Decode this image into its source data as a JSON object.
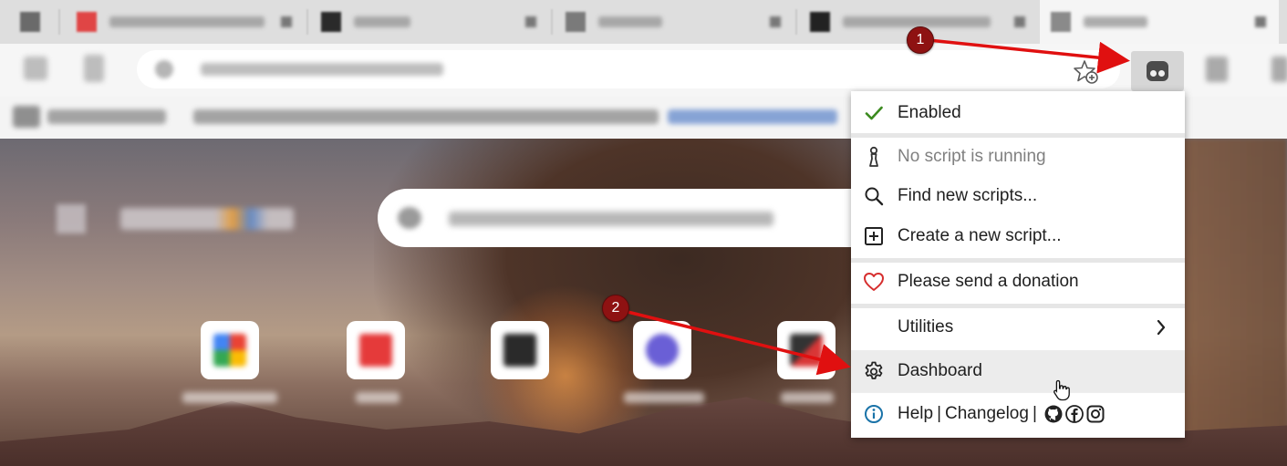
{
  "menu": {
    "enabled": "Enabled",
    "no_script": "No script is running",
    "find_scripts": "Find new scripts...",
    "create_script": "Create a new script...",
    "donation": "Please send a donation",
    "utilities": "Utilities",
    "dashboard": "Dashboard",
    "help": "Help",
    "help_sep1": "|",
    "changelog": "Changelog",
    "help_sep2": "|"
  },
  "annotations": {
    "step1": "1",
    "step2": "2"
  },
  "colors": {
    "check": "#3b8a1e",
    "heart": "#d62e2e",
    "info": "#1a73a8",
    "annotation": "#8e1212",
    "arrow": "#e01010"
  },
  "icons": {
    "enabled": "checkmark-icon",
    "no_script": "script-figure-icon",
    "find_scripts": "search-icon",
    "create_script": "plus-square-icon",
    "donation": "heart-icon",
    "utilities": "chevron-right-icon",
    "dashboard": "gear-icon",
    "help": "info-icon",
    "social": [
      "github-icon",
      "facebook-icon",
      "instagram-icon"
    ],
    "extension": "tampermonkey-icon",
    "bookmark_star": "add-favorite-icon"
  }
}
